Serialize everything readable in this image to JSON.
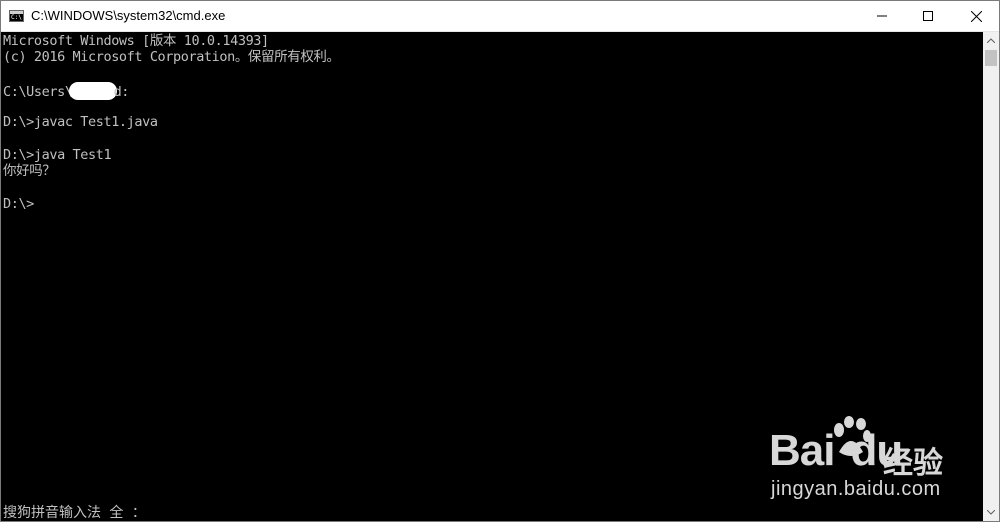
{
  "window": {
    "title": "C:\\WINDOWS\\system32\\cmd.exe",
    "icon": "cmd-icon",
    "controls": {
      "minimize_icon": "minimize-icon",
      "maximize_icon": "maximize-icon",
      "close_icon": "close-icon"
    }
  },
  "console": {
    "lines": [
      "Microsoft Windows [版本 10.0.14393]",
      "(c) 2016 Microsoft Corporation。保留所有权利。",
      "",
      {
        "before": "C:\\Users\\",
        "after": "d:"
      },
      "",
      "D:\\>javac Test1.java",
      "",
      "D:\\>java Test1",
      "你好吗？",
      "",
      "D:\\>"
    ],
    "ime_status": "搜狗拼音输入法 全 ：",
    "foreground_color": "#c0c0c0",
    "background_color": "#000000"
  },
  "watermark": {
    "logo": "Bai du 经验",
    "logo_brand": "Bai",
    "logo_brand2": "du",
    "logo_cn": "经验",
    "url": "jingyan.baidu.com"
  }
}
